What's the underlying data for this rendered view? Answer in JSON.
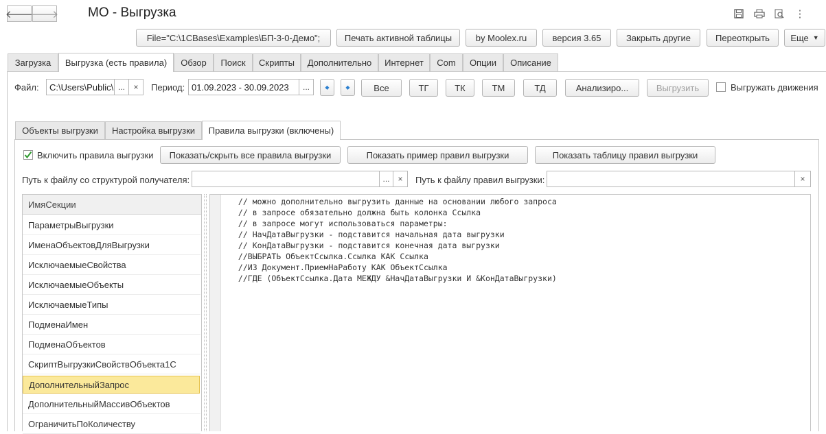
{
  "header": {
    "title": "МО - Выгрузка",
    "icons": [
      "save-icon",
      "print-icon",
      "preview-icon",
      "more-vertical-icon"
    ]
  },
  "toolbar": {
    "file_path": "File=\"C:\\1CBases\\Examples\\БП-3-0-Демо\";",
    "print_active_table": "Печать активной таблицы",
    "by_moolex": "by Moolex.ru",
    "version": "версия 3.65",
    "close_others": "Закрыть другие",
    "reopen": "Переоткрыть",
    "more": "Еще"
  },
  "main_tabs": [
    "Загрузка",
    "Выгрузка (есть правила)",
    "Обзор",
    "Поиск",
    "Скрипты",
    "Дополнительно",
    "Интернет",
    "Com",
    "Опции",
    "Описание"
  ],
  "params": {
    "file_label": "Файл:",
    "file_value": "C:\\Users\\Public\\",
    "ellipsis": "...",
    "clear": "×",
    "period_label": "Период:",
    "period_value": "01.09.2023 - 30.09.2023",
    "btn_all": "Все",
    "btn_tg": "ТГ",
    "btn_tk": "ТК",
    "btn_tm": "ТМ",
    "btn_td": "ТД",
    "btn_analyze": "Анализиро...",
    "btn_export": "Выгрузить",
    "export_movements": "Выгружать движения"
  },
  "sub_tabs": [
    "Объекты выгрузки",
    "Настройка выгрузки",
    "Правила выгрузки (включены)"
  ],
  "rules": {
    "enable_rules": "Включить правила выгрузки",
    "show_hide_all": "Показать/скрыть все правила выгрузки",
    "show_example": "Показать пример правил выгрузки",
    "show_table": "Показать таблицу правил выгрузки",
    "receiver_path_label": "Путь к файлу со структурой получателя:",
    "rules_path_label": "Путь к файлу правил выгрузки:"
  },
  "section_list": {
    "header": "ИмяСекции",
    "items": [
      "ПараметрыВыгрузки",
      "ИменаОбъектовДляВыгрузки",
      "ИсключаемыеСвойства",
      "ИсключаемыеОбъекты",
      "ИсключаемыеТипы",
      "ПодменаИмен",
      "ПодменаОбъектов",
      "СкриптВыгрузкиСвойствОбъекта1С",
      "ДополнительныйЗапрос",
      "ДополнительныйМассивОбъектов",
      "ОграничитьПоКоличеству"
    ],
    "selected": "ДополнительныйЗапрос"
  },
  "code_text": " // можно дополнительно выгрузить данные на основании любого запроса\n // в запросе обязательно должна быть колонка Ссылка\n // в запросе могут использоваться параметры:\n // НачДатаВыгрузки - подставится начальная дата выгрузки\n // КонДатаВыгрузки - подставится конечная дата выгрузки\n //ВЫБРАТЬ ОбъектСсылка.Ссылка КАК Ссылка\n //ИЗ Документ.ПриемНаРаботу КАК ОбъектСсылка\n //ГДЕ (ОбъектСсылка.Дата МЕЖДУ &НачДатаВыгрузки И &КонДатаВыгрузки)"
}
